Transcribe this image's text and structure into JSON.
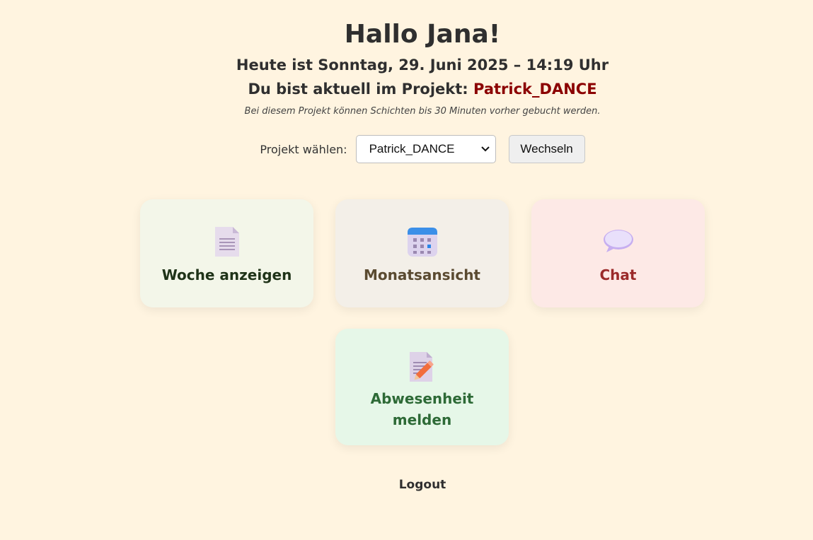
{
  "greeting": "Hallo Jana!",
  "date_line": "Heute ist Sonntag, 29. Juni 2025 – 14:19 Uhr",
  "project_prefix": "Du bist aktuell im Projekt: ",
  "current_project": "Patrick_DANCE",
  "booking_note": "Bei diesem Projekt können Schichten bis 30 Minuten vorher gebucht werden.",
  "project_select": {
    "label": "Projekt wählen:",
    "selected": "Patrick_DANCE",
    "button_label": "Wechseln"
  },
  "cards": [
    {
      "label": "Woche anzeigen",
      "icon": "document-icon",
      "color": "#f3f6e9"
    },
    {
      "label": "Monatsansicht",
      "icon": "calendar-icon",
      "color": "#f3efe8"
    },
    {
      "label": "Chat",
      "icon": "speech-bubble-icon",
      "color": "#fde9e6"
    },
    {
      "label": "Abwesenheit melden",
      "icon": "document-pencil-icon",
      "color": "#e6f7e8"
    }
  ],
  "logout_label": "Logout",
  "colors": {
    "background": "#fff4e0",
    "project_highlight": "#8b0000"
  }
}
